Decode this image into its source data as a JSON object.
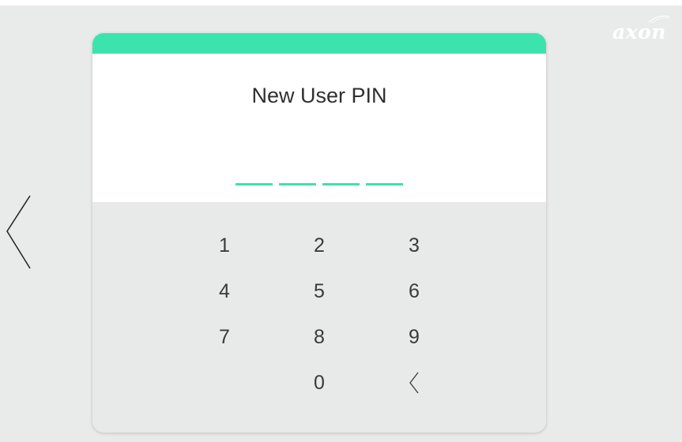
{
  "branding": {
    "logo_text": "axon",
    "logo_color": "#ffffff"
  },
  "colors": {
    "accent": "#3de3ac",
    "background": "#e9eaea",
    "card_header": "#ffffff"
  },
  "navigation": {
    "back_icon": "chevron-left-icon"
  },
  "dialog": {
    "title": "New User PIN",
    "pin_length": 4,
    "pin_entered": 0
  },
  "keypad": {
    "rows": [
      [
        "1",
        "2",
        "3"
      ],
      [
        "4",
        "5",
        "6"
      ],
      [
        "7",
        "8",
        "9"
      ],
      [
        "",
        "0",
        "backspace"
      ]
    ],
    "backspace_icon": "backspace-chevron-icon"
  }
}
